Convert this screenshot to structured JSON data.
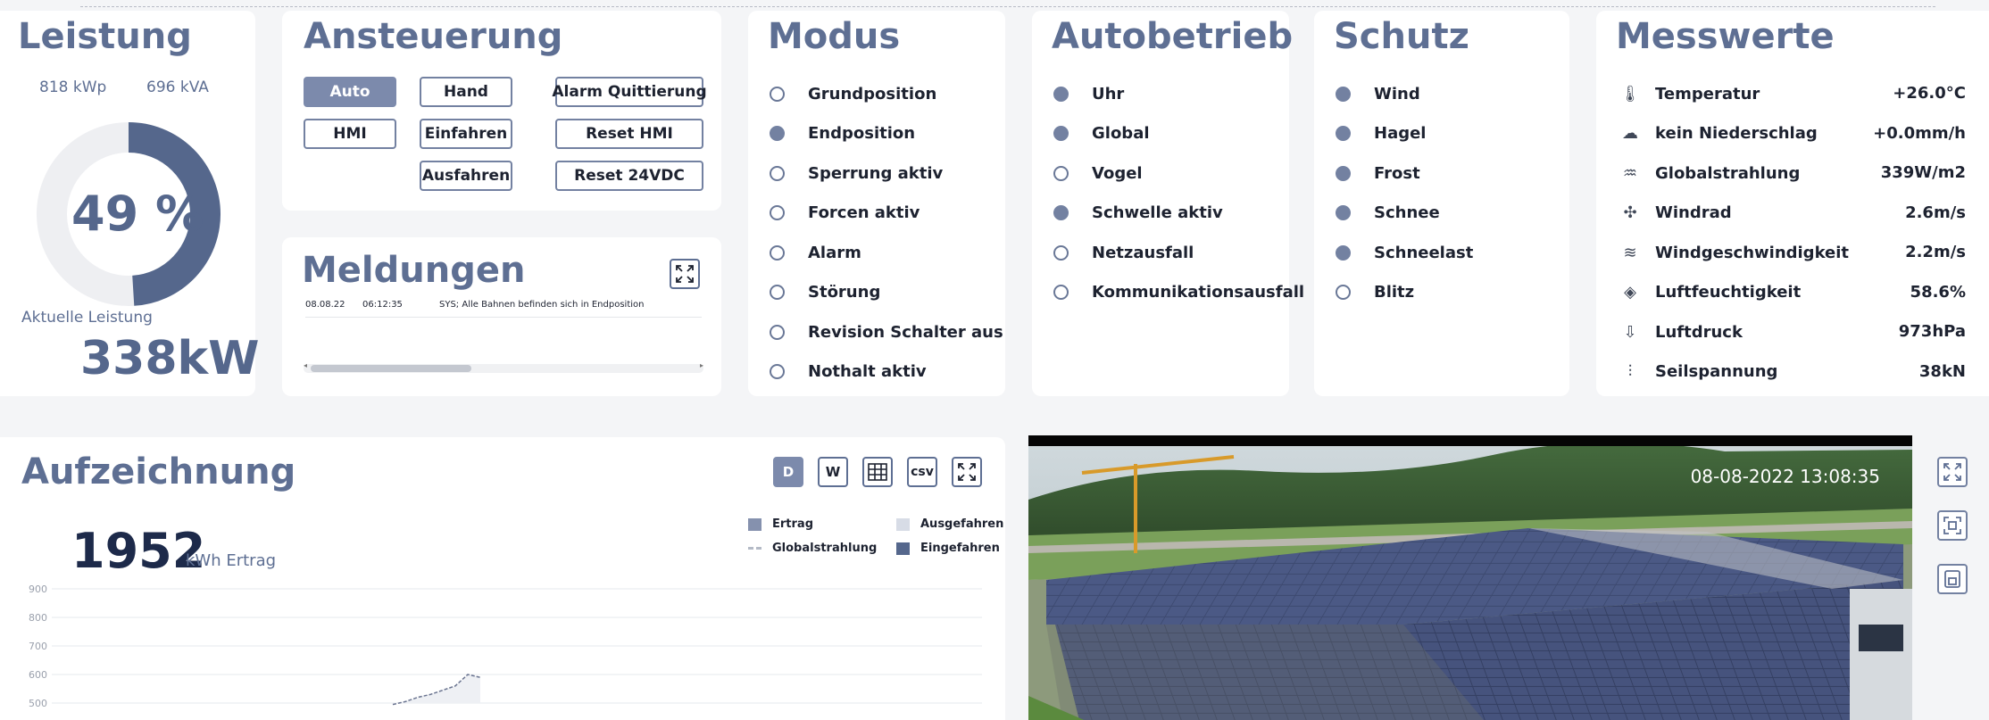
{
  "leistung": {
    "title": "Leistung",
    "kwp": "818 kWp",
    "kva": "696 kVA",
    "percent_label": "49 %",
    "percent": 49,
    "current_label": "Aktuelle Leistung",
    "current_value": "338kW"
  },
  "ansteuerung": {
    "title": "Ansteuerung",
    "buttons": [
      "Auto",
      "Hand",
      "Alarm Quittierung",
      "HMI",
      "Einfahren",
      "Reset HMI",
      "Ausfahren",
      "Reset 24VDC"
    ]
  },
  "meldungen": {
    "title": "Meldungen",
    "row": {
      "date": "08.08.22",
      "time": "06:12:35",
      "text": "SYS; Alle Bahnen befinden sich in Endposition"
    }
  },
  "modus": {
    "title": "Modus",
    "items": [
      {
        "label": "Grundposition",
        "on": false
      },
      {
        "label": "Endposition",
        "on": true
      },
      {
        "label": "Sperrung aktiv",
        "on": false
      },
      {
        "label": "Forcen aktiv",
        "on": false
      },
      {
        "label": "Alarm",
        "on": false
      },
      {
        "label": "Störung",
        "on": false
      },
      {
        "label": "Revision Schalter aus",
        "on": false
      },
      {
        "label": "Nothalt aktiv",
        "on": false
      }
    ]
  },
  "autobetrieb": {
    "title": "Autobetrieb",
    "items": [
      {
        "label": "Uhr",
        "on": true
      },
      {
        "label": "Global",
        "on": true
      },
      {
        "label": "Vogel",
        "on": false
      },
      {
        "label": "Schwelle aktiv",
        "on": true
      },
      {
        "label": "Netzausfall",
        "on": false
      },
      {
        "label": "Kommunikationsausfall",
        "on": false
      }
    ]
  },
  "schutz": {
    "title": "Schutz",
    "items": [
      {
        "label": "Wind",
        "on": true
      },
      {
        "label": "Hagel",
        "on": true
      },
      {
        "label": "Frost",
        "on": true
      },
      {
        "label": "Schnee",
        "on": true
      },
      {
        "label": "Schneelast",
        "on": true
      },
      {
        "label": "Blitz",
        "on": false
      }
    ]
  },
  "messwerte": {
    "title": "Messwerte",
    "items": [
      {
        "label": "Temperatur",
        "value": "+26.0°C",
        "icon": "thermometer-icon"
      },
      {
        "label": "kein Niederschlag",
        "value": "+0.0mm/h",
        "icon": "rain-cloud-icon"
      },
      {
        "label": "Globalstrahlung",
        "value": "339W/m2",
        "icon": "radiation-icon"
      },
      {
        "label": "Windrad",
        "value": "2.6m/s",
        "icon": "wind-turbine-icon"
      },
      {
        "label": "Windgeschwindigkeit",
        "value": "2.2m/s",
        "icon": "wind-icon"
      },
      {
        "label": "Luftfeuchtigkeit",
        "value": "58.6%",
        "icon": "humidity-icon"
      },
      {
        "label": "Luftdruck",
        "value": "973hPa",
        "icon": "pressure-icon"
      },
      {
        "label": "Seilspannung",
        "value": "38kN",
        "icon": "cable-tension-icon"
      }
    ]
  },
  "aufzeichnung": {
    "title": "Aufzeichnung",
    "total_value": "1952",
    "total_unit": "kWh Ertrag",
    "buttons": {
      "day": "D",
      "week": "W",
      "csv": "csv"
    },
    "legend": [
      "Ertrag",
      "Ausgefahren",
      "Globalstrahlung",
      "Eingefahren"
    ]
  },
  "chart_data": {
    "type": "area",
    "x": [
      0,
      1,
      2,
      3,
      4,
      5,
      6,
      7
    ],
    "series": [
      {
        "name": "Globalstrahlung",
        "values": [
          495,
          505,
          520,
          530,
          545,
          560,
          600,
          590
        ]
      }
    ],
    "yticks": [
      900,
      800,
      700,
      600,
      500
    ],
    "ylim": [
      500,
      900
    ],
    "grid": true,
    "legend": "top-right"
  },
  "camera": {
    "timestamp": "08-08-2022 13:08:35"
  },
  "colors": {
    "accent": "#5e6f93",
    "donut_fill": "#55678c",
    "donut_track": "#eeeff2",
    "legend_ertrag": "#8591ae",
    "legend_ausgefahren": "#d7dce6",
    "legend_global": "#b4bac6",
    "legend_eingefahren": "#55678c"
  }
}
